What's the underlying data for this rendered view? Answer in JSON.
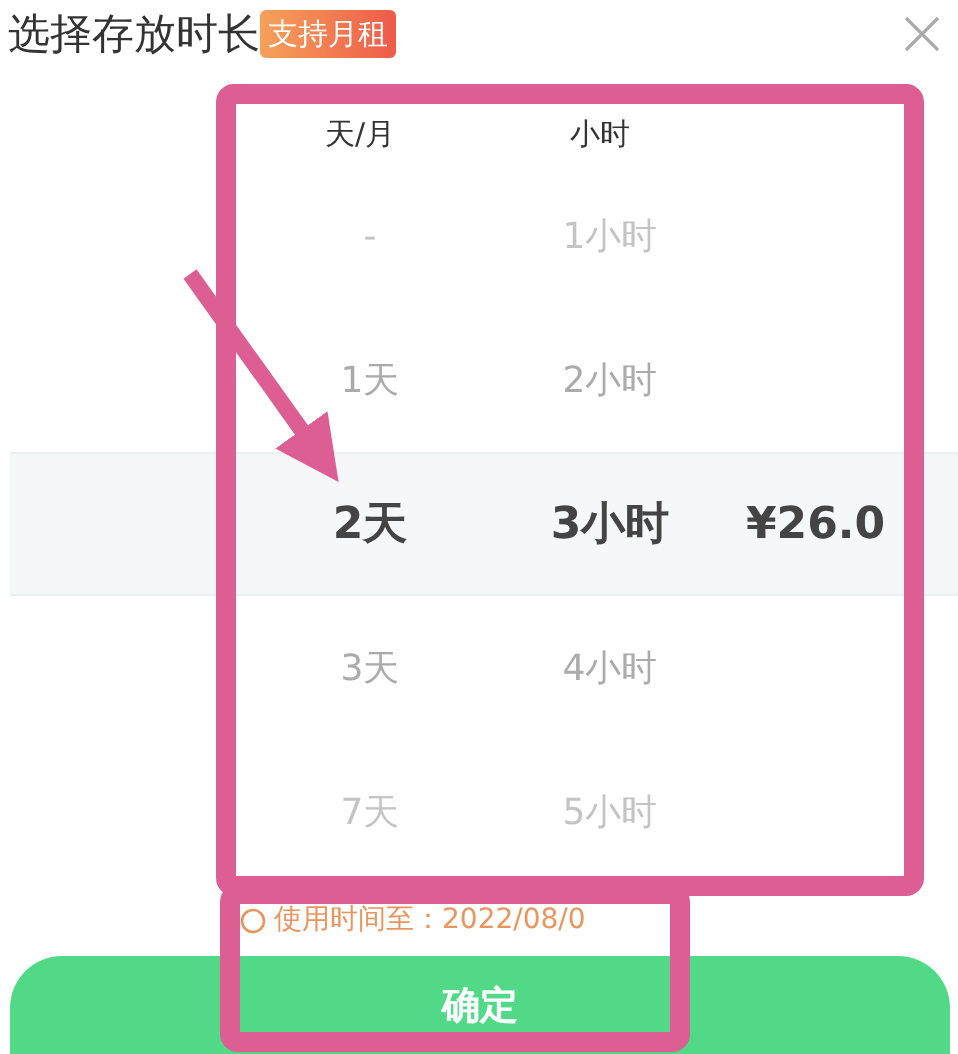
{
  "header": {
    "title": "选择存放时长",
    "badge": "支持月租"
  },
  "picker": {
    "columns": [
      "天/月",
      "小时"
    ],
    "rows": [
      {
        "day": "-",
        "hour": "1小时",
        "selected": false
      },
      {
        "day": "1天",
        "hour": "2小时",
        "selected": false
      },
      {
        "day": "2天",
        "hour": "3小时",
        "price": "¥26.0",
        "selected": true
      },
      {
        "day": "3天",
        "hour": "4小时",
        "selected": false
      },
      {
        "day": "7天",
        "hour": "5小时",
        "selected": false
      }
    ]
  },
  "notice": "使用时间至：2022/08/0",
  "confirm_button": "确定",
  "annotations": [
    {
      "kind": "frame"
    },
    {
      "kind": "frame"
    },
    {
      "kind": "arrow"
    }
  ]
}
